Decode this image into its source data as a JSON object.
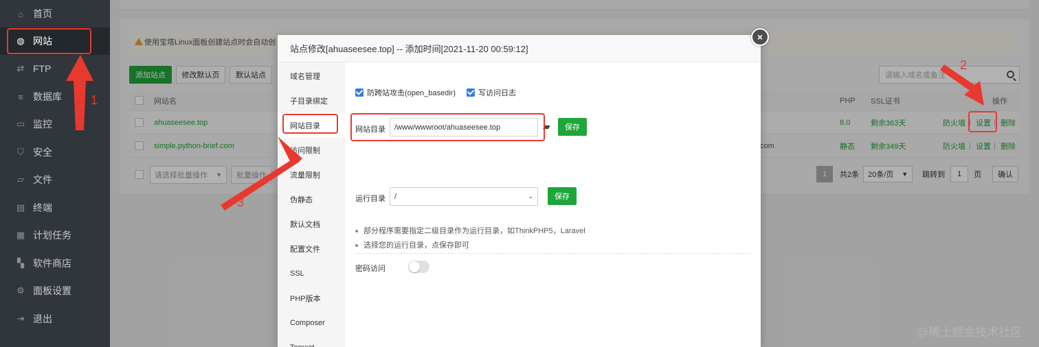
{
  "sidebar": {
    "items": [
      {
        "label": "首页",
        "icon": "home-icon"
      },
      {
        "label": "网站",
        "icon": "globe-icon"
      },
      {
        "label": "FTP",
        "icon": "ftp-icon"
      },
      {
        "label": "数据库",
        "icon": "database-icon"
      },
      {
        "label": "监控",
        "icon": "monitor-icon"
      },
      {
        "label": "安全",
        "icon": "shield-icon"
      },
      {
        "label": "文件",
        "icon": "folder-icon"
      },
      {
        "label": "终端",
        "icon": "terminal-icon"
      },
      {
        "label": "计划任务",
        "icon": "calendar-icon"
      },
      {
        "label": "软件商店",
        "icon": "apps-icon"
      },
      {
        "label": "面板设置",
        "icon": "gear-icon"
      },
      {
        "label": "退出",
        "icon": "logout-icon"
      }
    ]
  },
  "notice": {
    "text": "使用宝塔Linux面板创建站点时会自动创"
  },
  "toolbar": {
    "add_site": "添加站点",
    "edit_default_page": "修改默认页",
    "default_site": "默认站点",
    "search_placeholder": "请输入域名或备注"
  },
  "table": {
    "headers": {
      "name": "网站名",
      "php": "PHP",
      "ssl": "SSL证书",
      "ops": "操作"
    },
    "rows": [
      {
        "name": "ahuaseesee.top",
        "php": "8.0",
        "ssl": "剩余363天",
        "firewall": "防火墙",
        "settings": "设置",
        "delete": "删除",
        "extra": ""
      },
      {
        "name": "simple.python-brief.com",
        "php": "静态",
        "ssl": "剩余349天",
        "firewall": "防火墙",
        "settings": "设置",
        "delete": "删除",
        "extra": "com"
      }
    ]
  },
  "pager": {
    "batch_placeholder": "请选择批量操作",
    "batch_button": "批量操作",
    "current_page": "1",
    "total": "共2条",
    "per_page": "20条/页",
    "jump_label": "跳转到",
    "jump_value": "1",
    "page_unit": "页",
    "confirm": "确认"
  },
  "dialog": {
    "title": "站点修改[ahuaseesee.top] -- 添加时间[2021-11-20 00:59:12]",
    "close": "×",
    "tabs": [
      "域名管理",
      "子目录绑定",
      "网站目录",
      "访问限制",
      "流量限制",
      "伪静态",
      "默认文档",
      "配置文件",
      "SSL",
      "PHP版本",
      "Composer",
      "Tomcat"
    ],
    "active_tab": "网站目录",
    "options": {
      "anti_cross": "防跨站攻击(open_basedir)",
      "access_log": "写访问日志"
    },
    "site_dir_label": "网站目录",
    "site_dir_value": "/www/wwwroot/ahuaseesee.top",
    "run_dir_label": "运行目录",
    "run_dir_value": "/",
    "save": "保存",
    "tips": [
      "部分程序需要指定二级目录作为运行目录，如ThinkPHP5，Laravel",
      "选择您的运行目录，点保存即可"
    ],
    "password_access": "密码访问"
  },
  "annotations": {
    "n1": "1",
    "n2": "2",
    "n3": "3",
    "color": "#e8392e"
  },
  "watermark": "@稀土掘金技术社区"
}
